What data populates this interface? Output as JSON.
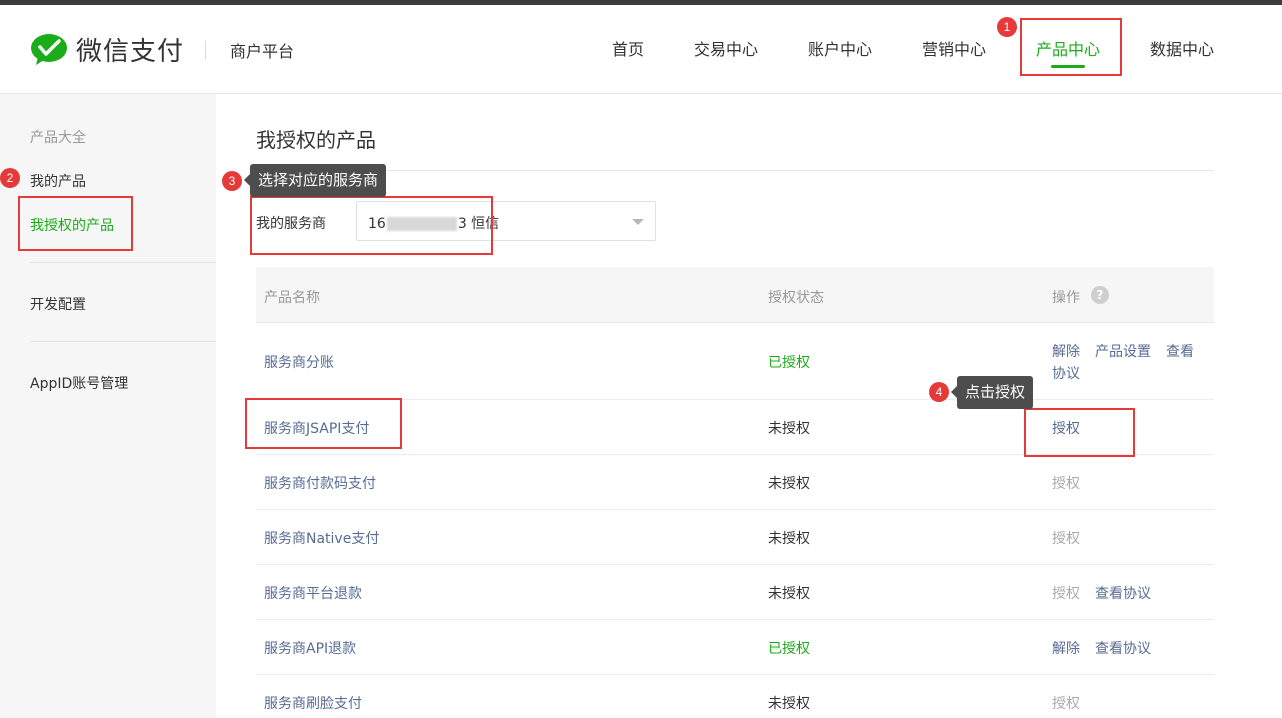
{
  "header": {
    "brand": "微信支付",
    "platform": "商户平台",
    "nav": [
      "首页",
      "交易中心",
      "账户中心",
      "营销中心",
      "产品中心",
      "数据中心"
    ],
    "active_nav": "产品中心"
  },
  "sidebar": {
    "group_title": "产品大全",
    "items": [
      "我的产品",
      "我授权的产品",
      "开发配置",
      "AppID账号管理"
    ],
    "active": "我授权的产品"
  },
  "main": {
    "title": "我授权的产品",
    "provider_label": "我的服务商",
    "provider_value_prefix": "16",
    "provider_value_suffix": "3 恒信",
    "columns": [
      "产品名称",
      "授权状态",
      "操作"
    ],
    "rows": [
      {
        "name": "服务商分账",
        "status": "已授权",
        "ops": [
          "解除",
          "产品设置",
          "查看",
          "协议"
        ]
      },
      {
        "name": "服务商JSAPI支付",
        "status": "未授权",
        "ops": [
          "授权"
        ]
      },
      {
        "name": "服务商付款码支付",
        "status": "未授权",
        "ops": [
          "授权"
        ]
      },
      {
        "name": "服务商Native支付",
        "status": "未授权",
        "ops": [
          "授权"
        ]
      },
      {
        "name": "服务商平台退款",
        "status": "未授权",
        "ops": [
          "授权",
          "查看协议"
        ]
      },
      {
        "name": "服务商API退款",
        "status": "已授权",
        "ops": [
          "解除",
          "查看协议"
        ]
      },
      {
        "name": "服务商刷脸支付",
        "status": "未授权",
        "ops": [
          "授权"
        ]
      }
    ]
  },
  "annotations": {
    "badges": [
      "1",
      "2",
      "3",
      "4"
    ],
    "tooltip_3": "选择对应的服务商",
    "tooltip_4": "点击授权"
  },
  "colors": {
    "brand_green": "#1aad19",
    "link_blue": "#576b95",
    "annotation_red": "#e63a3a"
  }
}
